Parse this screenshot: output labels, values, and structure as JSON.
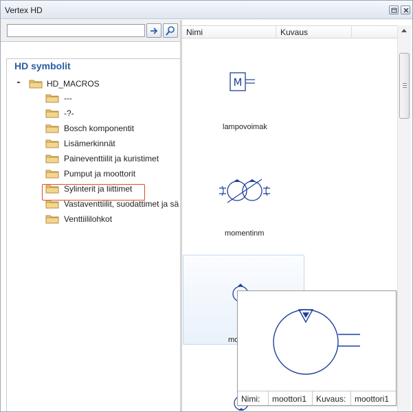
{
  "window": {
    "title": "Vertex HD"
  },
  "search": {
    "value": "",
    "placeholder": ""
  },
  "tree": {
    "heading": "HD symbolit",
    "root": "HD_MACROS",
    "items": [
      {
        "label": "---"
      },
      {
        "label": "-?-"
      },
      {
        "label": "Bosch komponentit"
      },
      {
        "label": "Lisämerkinnät"
      },
      {
        "label": "Paineventtiilit ja kuristimet"
      },
      {
        "label": "Pumput ja moottorit",
        "selected": true
      },
      {
        "label": "Sylinterit ja liittimet"
      },
      {
        "label": "Vastaventtiilit, suodattimet ja sä"
      },
      {
        "label": "Venttiililohkot"
      }
    ]
  },
  "list": {
    "columns": [
      "Nimi",
      "Kuvaus"
    ],
    "symbols": [
      {
        "name": "lampovoimak"
      },
      {
        "name": "momentinm"
      },
      {
        "name": "mo"
      }
    ]
  },
  "tooltip": {
    "name_label": "Nimi:",
    "name_value": "moottori1",
    "desc_label": "Kuvaus:",
    "desc_value": "moottori1"
  },
  "colors": {
    "heading": "#2a5d9f",
    "symbol_stroke": "#1f3f9a",
    "selection_border": "#e0492f",
    "folder": "#e8c77a"
  }
}
